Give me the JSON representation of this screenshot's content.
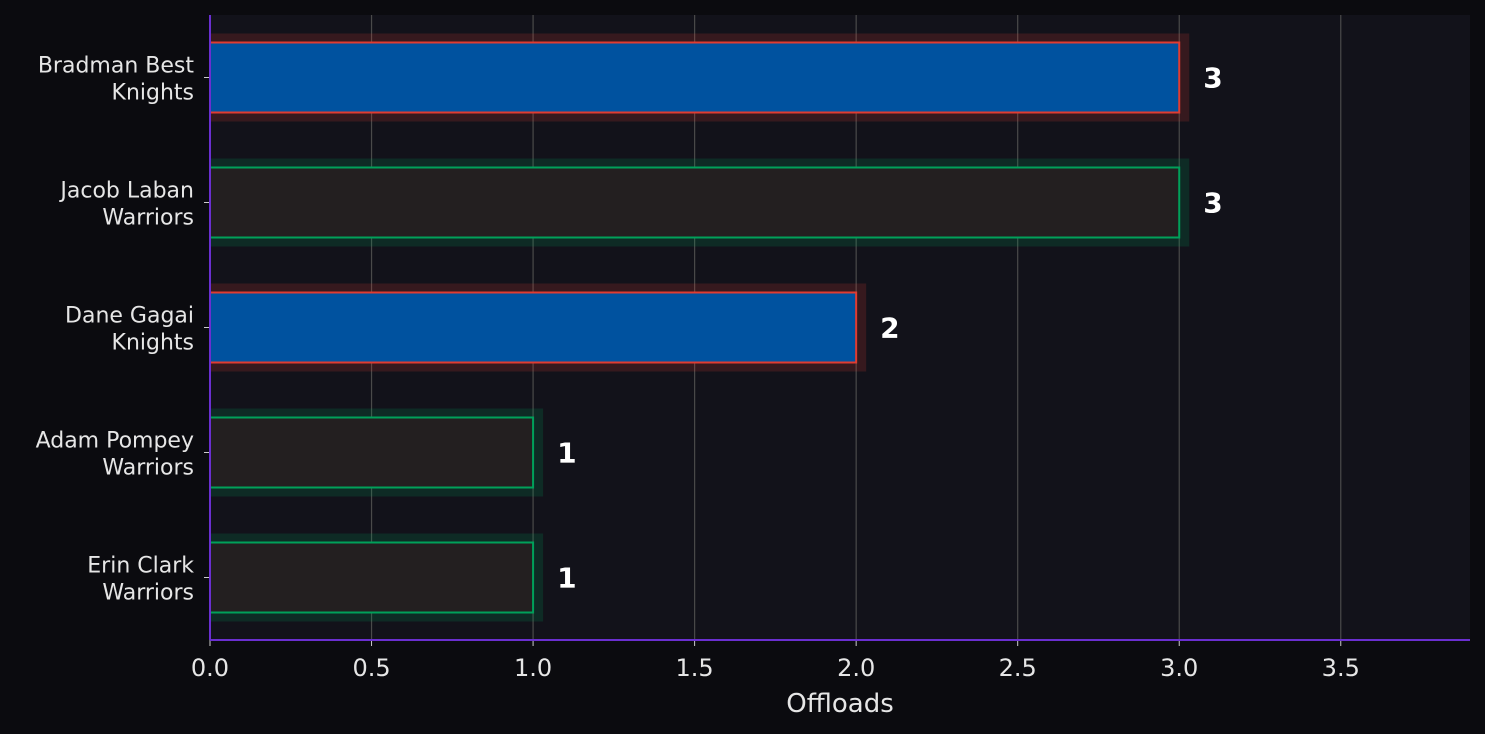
{
  "chart_data": {
    "type": "bar",
    "orientation": "horizontal",
    "categories": [
      {
        "name": "Bradman Best",
        "team": "Knights"
      },
      {
        "name": "Jacob Laban",
        "team": "Warriors"
      },
      {
        "name": "Dane Gagai",
        "team": "Knights"
      },
      {
        "name": "Adam Pompey",
        "team": "Warriors"
      },
      {
        "name": "Erin Clark",
        "team": "Warriors"
      }
    ],
    "values": [
      3,
      3,
      2,
      1,
      1
    ],
    "value_labels": [
      "3",
      "3",
      "2",
      "1",
      "1"
    ],
    "xlabel": "Offloads",
    "ylabel": "",
    "title": "",
    "xlim": [
      0,
      3.9
    ],
    "xticks": [
      "0.0",
      "0.5",
      "1.0",
      "1.5",
      "2.0",
      "2.5",
      "3.0",
      "3.5"
    ],
    "xtick_values": [
      0,
      0.5,
      1.0,
      1.5,
      2.0,
      2.5,
      3.0,
      3.5
    ],
    "grid": "vertical",
    "team_styles": {
      "Knights": {
        "fill": "#00529f",
        "edge": "#e03c31",
        "glow": "#e03c31"
      },
      "Warriors": {
        "fill": "#231f20",
        "edge": "#00a05a",
        "glow": "#00a05a"
      }
    },
    "colors": {
      "background": "#0b0b0f",
      "plot_background": "#12121a",
      "axis_spine": "#6a2fd0",
      "grid": "#4a4a4a"
    }
  }
}
